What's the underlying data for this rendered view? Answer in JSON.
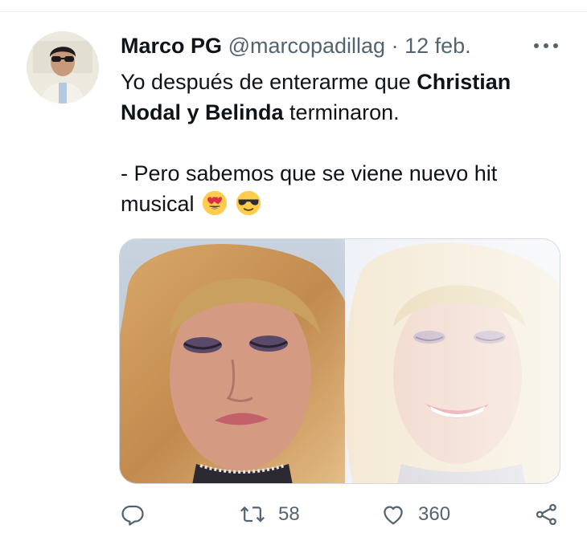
{
  "tweet": {
    "author_name": "Marco PG",
    "author_handle": "@marcopadillag",
    "separator": "·",
    "date": "12 feb.",
    "text": {
      "line1_pre": "Yo después de enterarme que ",
      "line1_bold": "Christian",
      "line2_bold": "Nodal y Belinda",
      "line2_post": " terminaron.",
      "line3": "- Pero sabemos que se viene nuevo hit",
      "line4": "musical"
    },
    "emojis": [
      "heart-eyes-emoji",
      "sunglasses-emoji"
    ]
  },
  "actions": {
    "reply": {
      "icon": "reply-icon"
    },
    "retweet": {
      "icon": "retweet-icon",
      "count": "58"
    },
    "like": {
      "icon": "heart-icon",
      "count": "360"
    },
    "share": {
      "icon": "share-icon"
    }
  },
  "colors": {
    "text": "#0f1419",
    "secondary": "#536471",
    "divider": "#eff3f4",
    "media_border": "#cfd9de"
  }
}
